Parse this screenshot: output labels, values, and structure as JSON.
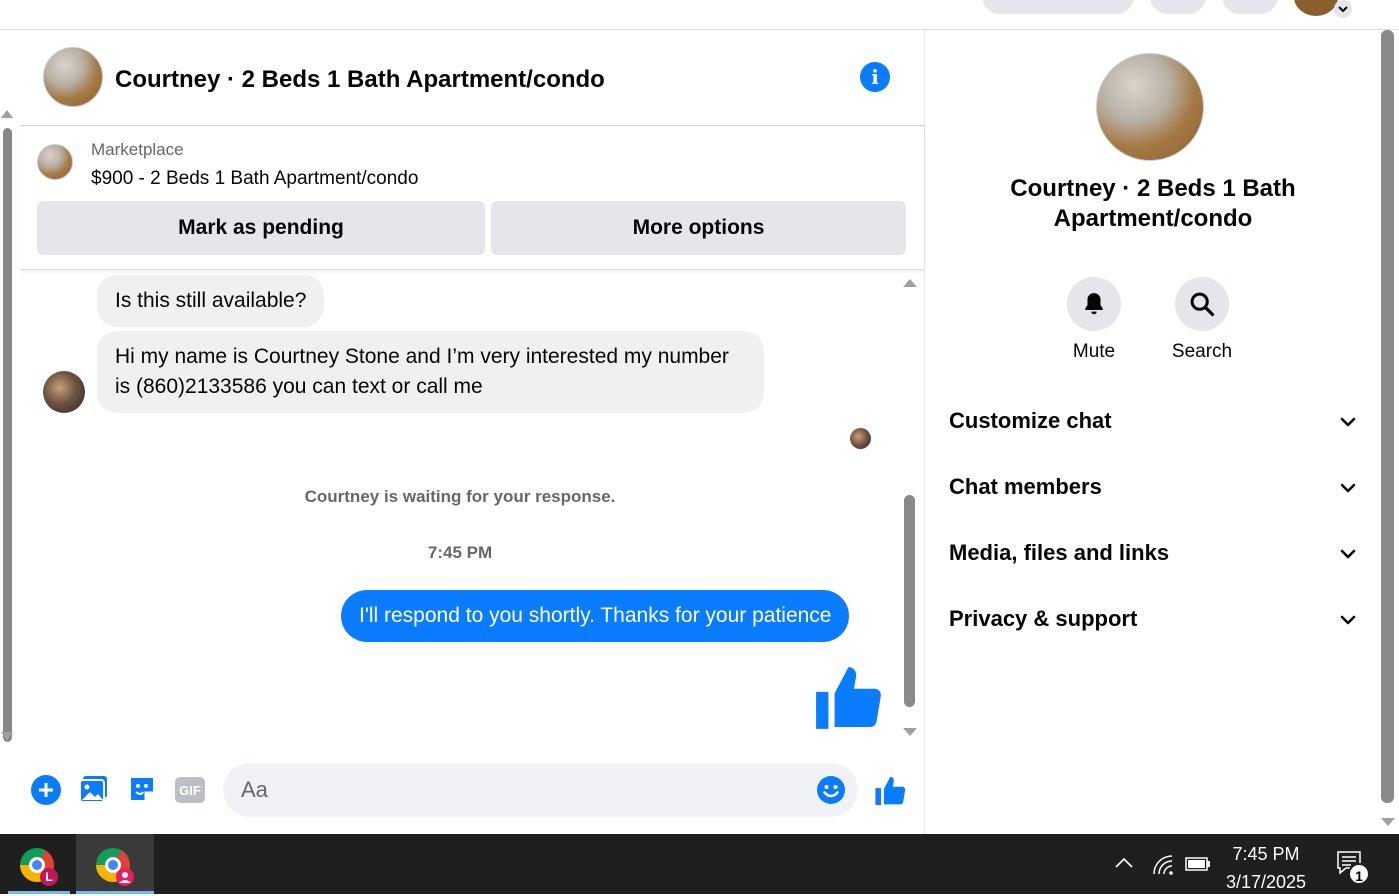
{
  "header": {
    "title": "Courtney · 2 Beds 1 Bath Apartment/condo"
  },
  "marketplace": {
    "label": "Marketplace",
    "item": "$900 - 2 Beds 1 Bath Apartment/condo",
    "mark_pending_label": "Mark as pending",
    "more_options_label": "More options"
  },
  "messages": {
    "incoming": [
      "Is this still available?",
      "Hi my name is Courtney Stone and I’m very interested my number is (860)2133586 you can text or call me"
    ],
    "waiting_notice": "Courtney is waiting for your response.",
    "timestamp": "7:45 PM",
    "outgoing": [
      "I'll respond to you shortly. Thanks for your patience"
    ]
  },
  "composer": {
    "placeholder": "Aa"
  },
  "right_panel": {
    "title": "Courtney · 2 Beds 1 Bath Apartment/condo",
    "actions": [
      {
        "label": "Mute",
        "icon": "bell-icon"
      },
      {
        "label": "Search",
        "icon": "search-icon"
      }
    ],
    "sections": [
      {
        "label": "Customize chat"
      },
      {
        "label": "Chat members"
      },
      {
        "label": "Media, files and links"
      },
      {
        "label": "Privacy & support"
      }
    ]
  },
  "taskbar": {
    "apps": [
      {
        "name": "chrome-profile-l",
        "badge": "L"
      },
      {
        "name": "chrome-profile-user",
        "badge": ""
      }
    ],
    "time": "7:45 PM",
    "date": "3/17/2025",
    "notification_count": "1"
  },
  "colors": {
    "accent": "#0a7cff",
    "incoming_bubble": "#f0f0f0",
    "button_gray": "#e4e6eb",
    "taskbar": "#1f1f1f"
  }
}
